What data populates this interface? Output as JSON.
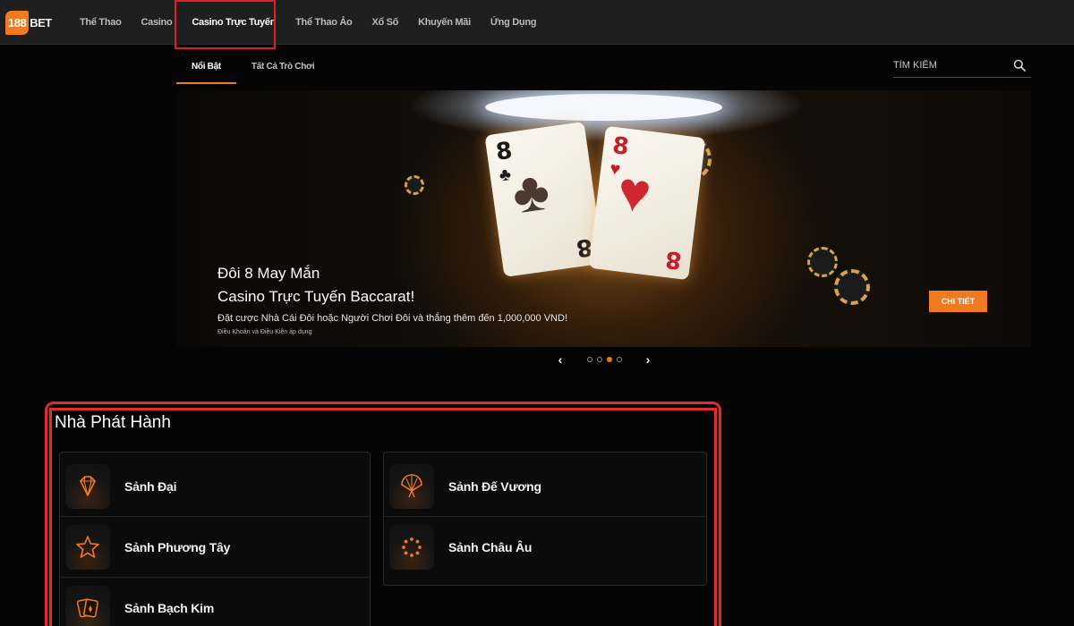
{
  "header": {
    "logo": {
      "number": "188",
      "text": "BET"
    },
    "nav": [
      {
        "label": "Thể Thao",
        "active": false
      },
      {
        "label": "Casino",
        "active": false
      },
      {
        "label": "Casino Trực Tuyến",
        "active": true
      },
      {
        "label": "Thể Thao Ảo",
        "active": false
      },
      {
        "label": "Xổ Số",
        "active": false
      },
      {
        "label": "Khuyến Mãi",
        "active": false
      },
      {
        "label": "Ứng Dụng",
        "active": false
      }
    ]
  },
  "subnav": {
    "tabs": [
      {
        "label": "Nổi Bật",
        "active": true
      },
      {
        "label": "Tất Cả Trò Chơi",
        "active": false
      }
    ],
    "search": {
      "placeholder": "TÌM KIẾM",
      "icon": "search-icon"
    }
  },
  "banner": {
    "title_line1": "Đôi 8 May Mắn",
    "title_line2": "Casino Trực Tuyến Baccarat!",
    "description": "Đặt cược Nhà Cái Đôi hoặc Người Chơi Đôi và thắng thêm đến 1,000,000 VND!",
    "terms": "Điều Khoản và Điều Kiện áp dụng",
    "cta_label": "CHI TIẾT",
    "cards": [
      {
        "rank": "8",
        "suit": "♣",
        "color": "#1a1a1a"
      },
      {
        "rank": "8",
        "suit": "♥",
        "color": "#c4202b"
      }
    ]
  },
  "carousel": {
    "prev": "‹",
    "next": "›",
    "dot_count": 4,
    "active_index": 2
  },
  "providers": {
    "title": "Nhà Phát Hành",
    "left": [
      {
        "label": "Sảnh Đại",
        "icon": "diamond-icon"
      },
      {
        "label": "Sảnh Phương Tây",
        "icon": "star-icon"
      },
      {
        "label": "Sảnh Bạch Kim",
        "icon": "playing-cards-icon"
      }
    ],
    "right": [
      {
        "label": "Sảnh Đế Vương",
        "icon": "fan-icon"
      },
      {
        "label": "Sảnh Châu Âu",
        "icon": "star-circle-icon"
      }
    ]
  },
  "colors": {
    "accent": "#f07a22",
    "highlight_border": "#e32b2b",
    "background": "#050505",
    "topbar": "#1f1f1f"
  }
}
